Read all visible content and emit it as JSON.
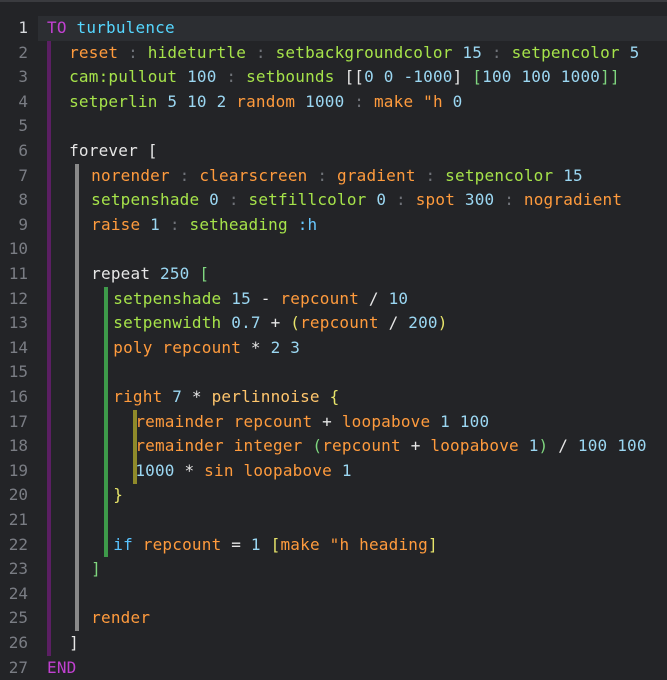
{
  "editor": {
    "lines": [
      {
        "n": "1",
        "tokens": [
          [
            "kw",
            "TO"
          ],
          [
            "op",
            " "
          ],
          [
            "def",
            "turbulence"
          ]
        ]
      },
      {
        "n": "2",
        "tokens": [
          [
            "sym",
            "reset"
          ],
          [
            "sep",
            " : "
          ],
          [
            "bi",
            "hideturtle"
          ],
          [
            "sep",
            " : "
          ],
          [
            "bi",
            "setbackgroundcolor"
          ],
          [
            "op",
            " "
          ],
          [
            "num",
            "15"
          ],
          [
            "sep",
            " : "
          ],
          [
            "bi",
            "setpencolor"
          ],
          [
            "op",
            " "
          ],
          [
            "num",
            "5"
          ]
        ]
      },
      {
        "n": "3",
        "tokens": [
          [
            "bi",
            "cam:pullout"
          ],
          [
            "op",
            " "
          ],
          [
            "num",
            "100"
          ],
          [
            "sep",
            " : "
          ],
          [
            "bi",
            "setbounds"
          ],
          [
            "op",
            " "
          ],
          [
            "br1",
            "[["
          ],
          [
            "num",
            "0 0 -1000"
          ],
          [
            "br1",
            "]"
          ],
          [
            "op",
            " "
          ],
          [
            "brg",
            "["
          ],
          [
            "num",
            "100 100 1000"
          ],
          [
            "brg",
            "]]"
          ]
        ]
      },
      {
        "n": "4",
        "tokens": [
          [
            "bi",
            "setperlin"
          ],
          [
            "op",
            " "
          ],
          [
            "num",
            "5 10 2"
          ],
          [
            "op",
            " "
          ],
          [
            "sym",
            "random"
          ],
          [
            "op",
            " "
          ],
          [
            "num",
            "1000"
          ],
          [
            "sep",
            " : "
          ],
          [
            "sym",
            "make"
          ],
          [
            "op",
            " "
          ],
          [
            "sym",
            "\"h"
          ],
          [
            "op",
            " "
          ],
          [
            "num",
            "0"
          ]
        ]
      },
      {
        "n": "5",
        "tokens": []
      },
      {
        "n": "6",
        "tokens": [
          [
            "op",
            "forever "
          ],
          [
            "br1",
            "["
          ]
        ]
      },
      {
        "n": "7",
        "tokens": [
          [
            "sym",
            "norender"
          ],
          [
            "sep",
            " : "
          ],
          [
            "sym",
            "clearscreen"
          ],
          [
            "sep",
            " : "
          ],
          [
            "sym",
            "gradient"
          ],
          [
            "sep",
            " : "
          ],
          [
            "bi",
            "setpencolor"
          ],
          [
            "op",
            " "
          ],
          [
            "num",
            "15"
          ]
        ]
      },
      {
        "n": "8",
        "tokens": [
          [
            "bi",
            "setpenshade"
          ],
          [
            "op",
            " "
          ],
          [
            "num",
            "0"
          ],
          [
            "sep",
            " : "
          ],
          [
            "bi",
            "setfillcolor"
          ],
          [
            "op",
            " "
          ],
          [
            "num",
            "0"
          ],
          [
            "sep",
            " : "
          ],
          [
            "sym",
            "spot"
          ],
          [
            "op",
            " "
          ],
          [
            "num",
            "300"
          ],
          [
            "sep",
            " : "
          ],
          [
            "sym",
            "nogradient"
          ]
        ]
      },
      {
        "n": "9",
        "tokens": [
          [
            "sym",
            "raise"
          ],
          [
            "op",
            " "
          ],
          [
            "num",
            "1"
          ],
          [
            "sep",
            " : "
          ],
          [
            "bi",
            "setheading"
          ],
          [
            "op",
            " "
          ],
          [
            "var",
            ":h"
          ]
        ]
      },
      {
        "n": "10",
        "tokens": []
      },
      {
        "n": "11",
        "tokens": [
          [
            "op",
            "repeat "
          ],
          [
            "num",
            "250"
          ],
          [
            "op",
            " "
          ],
          [
            "brg",
            "["
          ]
        ]
      },
      {
        "n": "12",
        "tokens": [
          [
            "bi",
            "setpenshade"
          ],
          [
            "op",
            " "
          ],
          [
            "num",
            "15"
          ],
          [
            "op",
            " - "
          ],
          [
            "sym",
            "repcount"
          ],
          [
            "op",
            " / "
          ],
          [
            "num",
            "10"
          ]
        ]
      },
      {
        "n": "13",
        "tokens": [
          [
            "bi",
            "setpenwidth"
          ],
          [
            "op",
            " "
          ],
          [
            "num",
            "0.7"
          ],
          [
            "op",
            " + "
          ],
          [
            "br2",
            "("
          ],
          [
            "sym",
            "repcount"
          ],
          [
            "op",
            " / "
          ],
          [
            "num",
            "200"
          ],
          [
            "br2",
            ")"
          ]
        ]
      },
      {
        "n": "14",
        "tokens": [
          [
            "sym",
            "poly"
          ],
          [
            "op",
            " "
          ],
          [
            "sym",
            "repcount"
          ],
          [
            "op",
            " * "
          ],
          [
            "num",
            "2 3"
          ]
        ]
      },
      {
        "n": "15",
        "tokens": []
      },
      {
        "n": "16",
        "tokens": [
          [
            "sym",
            "right"
          ],
          [
            "op",
            " "
          ],
          [
            "num",
            "7"
          ],
          [
            "op",
            " * "
          ],
          [
            "fn",
            "perlinnoise"
          ],
          [
            "op",
            " "
          ],
          [
            "br2",
            "{"
          ]
        ]
      },
      {
        "n": "17",
        "tokens": [
          [
            "sym",
            "remainder"
          ],
          [
            "op",
            " "
          ],
          [
            "sym",
            "repcount"
          ],
          [
            "op",
            " + "
          ],
          [
            "sym",
            "loopabove"
          ],
          [
            "op",
            " "
          ],
          [
            "num",
            "1 100"
          ]
        ]
      },
      {
        "n": "18",
        "tokens": [
          [
            "sym",
            "remainder"
          ],
          [
            "op",
            " "
          ],
          [
            "sym",
            "integer"
          ],
          [
            "op",
            " "
          ],
          [
            "brg",
            "("
          ],
          [
            "sym",
            "repcount"
          ],
          [
            "op",
            " + "
          ],
          [
            "sym",
            "loopabove"
          ],
          [
            "op",
            " "
          ],
          [
            "num",
            "1"
          ],
          [
            "brg",
            ")"
          ],
          [
            "op",
            " / "
          ],
          [
            "num",
            "100 100"
          ]
        ]
      },
      {
        "n": "19",
        "tokens": [
          [
            "num",
            "1000"
          ],
          [
            "op",
            " * "
          ],
          [
            "sym",
            "sin"
          ],
          [
            "op",
            " "
          ],
          [
            "sym",
            "loopabove"
          ],
          [
            "op",
            " "
          ],
          [
            "num",
            "1"
          ]
        ]
      },
      {
        "n": "20",
        "tokens": [
          [
            "br2",
            "}"
          ]
        ]
      },
      {
        "n": "21",
        "tokens": []
      },
      {
        "n": "22",
        "tokens": [
          [
            "kwb",
            "if"
          ],
          [
            "op",
            " "
          ],
          [
            "sym",
            "repcount"
          ],
          [
            "op",
            " = "
          ],
          [
            "num",
            "1"
          ],
          [
            "op",
            " "
          ],
          [
            "br2",
            "["
          ],
          [
            "sym",
            "make"
          ],
          [
            "op",
            " "
          ],
          [
            "sym",
            "\"h heading"
          ],
          [
            "br2",
            "]"
          ]
        ]
      },
      {
        "n": "23",
        "tokens": [
          [
            "brg",
            "]"
          ]
        ]
      },
      {
        "n": "24",
        "tokens": []
      },
      {
        "n": "25",
        "tokens": [
          [
            "sym",
            "render"
          ]
        ]
      },
      {
        "n": "26",
        "tokens": [
          [
            "br1",
            "]"
          ]
        ]
      },
      {
        "n": "27",
        "tokens": [
          [
            "kw",
            "END"
          ]
        ]
      }
    ],
    "current_line": "1"
  },
  "colors": {
    "background": "#232427",
    "current_line": "#2c2e32",
    "guide_level1": "#5b1f63",
    "guide_level2": "#8a8a8a",
    "guide_level3": "#3e9a4a",
    "guide_level4": "#8f8a2a"
  }
}
